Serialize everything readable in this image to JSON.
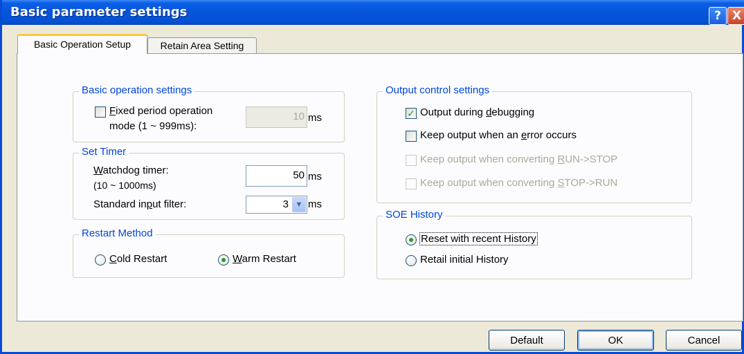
{
  "window": {
    "title": "Basic parameter settings",
    "help_label": "?",
    "close_label": "X"
  },
  "tabs": [
    {
      "label": "Basic Operation Setup",
      "active": true
    },
    {
      "label": "Retain Area Setting",
      "active": false
    }
  ],
  "basic_operation": {
    "legend": "Basic operation settings",
    "fixed_period": {
      "checked": false,
      "label_line1_accel": "F",
      "label_line1_rest": "ixed period operation",
      "label_line2": "mode (1 ~ 999ms):",
      "value": "10",
      "unit": "ms"
    }
  },
  "set_timer": {
    "legend": "Set Timer",
    "watchdog": {
      "label_accel": "W",
      "label_rest": "atchdog timer:",
      "range": "(10 ~ 1000ms)",
      "value": "50",
      "unit": "ms"
    },
    "input_filter": {
      "label_pre": "Standard in",
      "label_accel": "p",
      "label_post": "ut filter:",
      "value": "3",
      "unit": "ms"
    }
  },
  "restart": {
    "legend": "Restart Method",
    "cold": {
      "accel": "C",
      "rest": "old Restart",
      "selected": false
    },
    "warm": {
      "accel": "W",
      "rest": "arm Restart",
      "selected": true
    }
  },
  "output_control": {
    "legend": "Output control settings",
    "items": [
      {
        "pre": "Output during ",
        "accel": "d",
        "post": "ebugging",
        "checked": true,
        "enabled": true
      },
      {
        "pre": "Keep output when an ",
        "accel": "e",
        "post": "rror occurs",
        "checked": false,
        "enabled": true
      },
      {
        "pre": "Keep output when converting ",
        "accel": "R",
        "post": "UN->STOP",
        "checked": false,
        "enabled": false
      },
      {
        "pre": "Keep output when converting ",
        "accel": "S",
        "post": "TOP->RUN",
        "checked": false,
        "enabled": false
      }
    ]
  },
  "soe_history": {
    "legend": "SOE History",
    "reset": {
      "label": "Reset with recent History",
      "selected": true
    },
    "retail": {
      "label": "Retail initial History",
      "selected": false
    }
  },
  "buttons": {
    "default": "Default",
    "ok": "OK",
    "cancel": "Cancel"
  },
  "icons": {
    "check": "check-mark-icon",
    "combo_arrow": "chevron-down-icon"
  }
}
